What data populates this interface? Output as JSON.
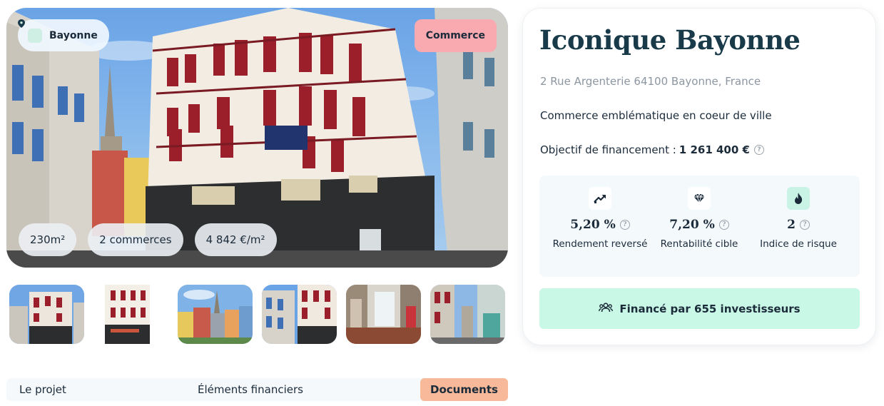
{
  "hero": {
    "location": "Bayonne",
    "category": "Commerce",
    "stats": [
      "230m²",
      "2 commerces",
      "4 842 €/m²"
    ]
  },
  "thumbnails": [
    "photo-1",
    "photo-2",
    "photo-3",
    "photo-4",
    "photo-5",
    "photo-6"
  ],
  "tabs": {
    "project": "Le projet",
    "financial": "Éléments financiers",
    "documents": "Documents"
  },
  "card": {
    "title": "Iconique Bayonne",
    "address": "2 Rue Argenterie 64100 Bayonne, France",
    "description": "Commerce emblématique en coeur de ville",
    "goal_label": "Objectif de financement :",
    "goal_value": "1 261 400 €",
    "metrics": [
      {
        "icon": "trend-up-icon",
        "value": "5,20 %",
        "label": "Rendement reversé"
      },
      {
        "icon": "diamond-icon",
        "value": "7,20 %",
        "label": "Rentabilité cible"
      },
      {
        "icon": "flame-icon",
        "value": "2",
        "label": "Indice de risque"
      }
    ],
    "funded_label": "Financé par 655 investisseurs"
  },
  "colors": {
    "category_pill": "#f9a9b0",
    "active_tab": "#f7b99a",
    "funded_banner": "#c9f8e6",
    "title": "#183a49"
  }
}
